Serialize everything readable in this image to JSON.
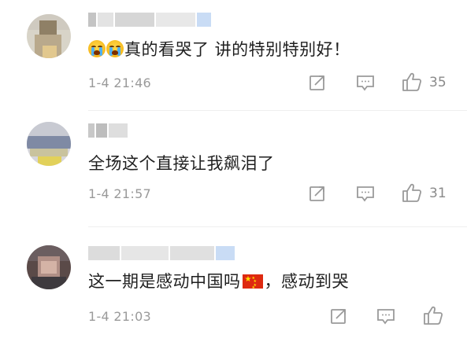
{
  "comments": [
    {
      "content_text": "真的看哭了 讲的特别特别好！",
      "timestamp": "1-4 21:46",
      "like_count": "35",
      "leading_emoji": "loudly-crying-face x2"
    },
    {
      "content_text": "全场这个直接让我飙泪了",
      "timestamp": "1-4 21:57",
      "like_count": "31"
    },
    {
      "content_before": "这一期是感动中国吗",
      "inline_emoji": "china-flag",
      "content_after": "，感动到哭",
      "timestamp": "1-4 21:03",
      "like_count": ""
    }
  ],
  "icons": {
    "share": "share-icon",
    "comment": "comment-icon",
    "like": "thumbs-up-icon"
  },
  "colors": {
    "text": "#1f1f1f",
    "meta": "#9a9a9a",
    "divider": "#eeeeee",
    "username_highlight": "#c9dcf5"
  }
}
